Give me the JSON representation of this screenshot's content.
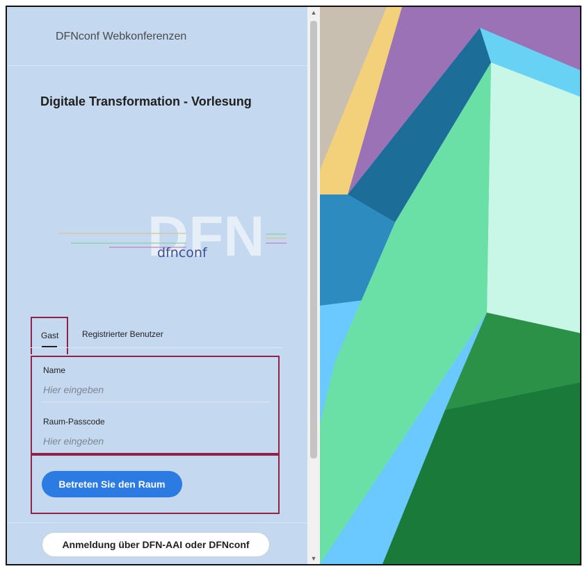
{
  "app": {
    "title": "DFNconf Webkonferenzen"
  },
  "meeting": {
    "title": "Digitale Transformation - Vorlesung"
  },
  "logo": {
    "big_text": "DFN",
    "small_text": "dfnconf"
  },
  "tabs": [
    {
      "label": "Gast",
      "selected": true
    },
    {
      "label": "Registrierter Benutzer",
      "selected": false
    }
  ],
  "form": {
    "name_label": "Name",
    "name_placeholder": "Hier eingeben",
    "passcode_label": "Raum-Passcode",
    "passcode_placeholder": "Hier eingeben"
  },
  "buttons": {
    "enter": "Betreten Sie den Raum",
    "login": "Anmeldung über DFN-AAI oder DFNconf"
  },
  "icons": {
    "scroll_up": "scroll-up-arrow-icon",
    "scroll_down": "scroll-down-arrow-icon"
  },
  "colors": {
    "panel_bg": "#c4d8ef",
    "accent_blue": "#2c7be2",
    "highlight_border": "#8f2245"
  }
}
